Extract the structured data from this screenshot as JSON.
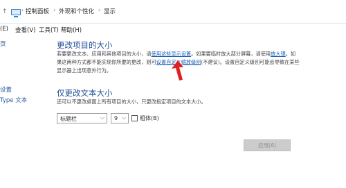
{
  "address_bar": {
    "up_arrow": "↑",
    "crumbs": [
      "控制面板",
      "外观和个性化",
      "显示"
    ],
    "separator": "›"
  },
  "menu": {
    "items": [
      "(E)",
      "查看(V)",
      "工具(T)",
      "帮助(H)"
    ]
  },
  "sidebar": {
    "items": [
      "页",
      "设置",
      "Type 文本"
    ]
  },
  "section1": {
    "title": "更改项目的大小",
    "line1_pre": "若要更改文本、应用和其他项目的大小，请",
    "line1_link1": "使用这些显示设置",
    "line1_mid": "。如果要临时放大部分屏幕，请使用",
    "line1_link2": "放大镜",
    "line1_post": "。如",
    "line2_pre": "果这两种方式都不能实现你所要的更改，则可",
    "line2_link": "设置自定义缩放级别",
    "line2_post": "(不建议)。设置自定义级别可能会导致在某些",
    "line3": "显示器上出现意外行为。"
  },
  "section2": {
    "title": "仅更改文本大小",
    "desc": "还可以不更改桌面上所有项目的大小，只更改指定项目的文本大小。",
    "item_select_value": "标题栏",
    "size_select_value": "9",
    "bold_label": "粗体(B)",
    "bold_checked": false
  },
  "apply_button": {
    "label": "应用(A)",
    "enabled": false
  },
  "colors": {
    "heading": "#1f4e99",
    "link": "#1a5fb4",
    "annotation_arrow": "#e02020"
  }
}
